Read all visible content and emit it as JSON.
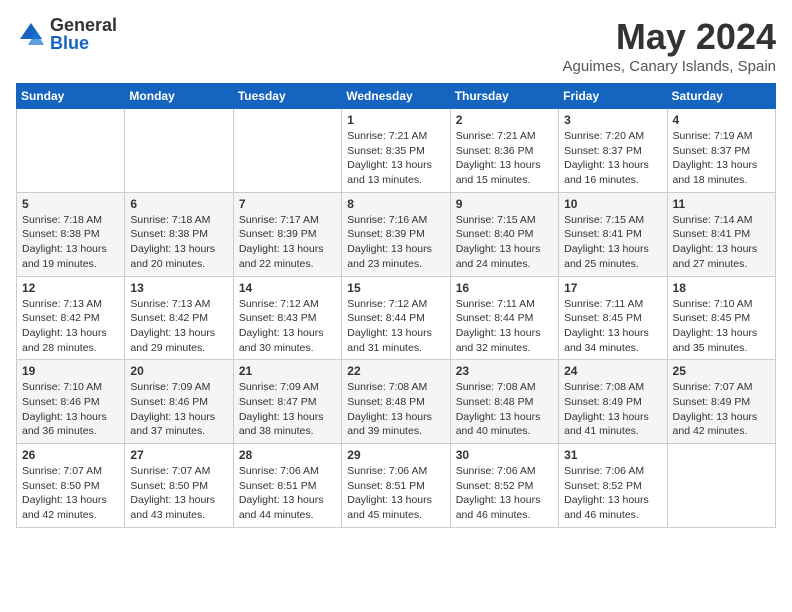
{
  "header": {
    "logo_general": "General",
    "logo_blue": "Blue",
    "month_title": "May 2024",
    "location": "Aguimes, Canary Islands, Spain"
  },
  "calendar": {
    "days_of_week": [
      "Sunday",
      "Monday",
      "Tuesday",
      "Wednesday",
      "Thursday",
      "Friday",
      "Saturday"
    ],
    "weeks": [
      [
        {
          "day": "",
          "info": ""
        },
        {
          "day": "",
          "info": ""
        },
        {
          "day": "",
          "info": ""
        },
        {
          "day": "1",
          "info": "Sunrise: 7:21 AM\nSunset: 8:35 PM\nDaylight: 13 hours and 13 minutes."
        },
        {
          "day": "2",
          "info": "Sunrise: 7:21 AM\nSunset: 8:36 PM\nDaylight: 13 hours and 15 minutes."
        },
        {
          "day": "3",
          "info": "Sunrise: 7:20 AM\nSunset: 8:37 PM\nDaylight: 13 hours and 16 minutes."
        },
        {
          "day": "4",
          "info": "Sunrise: 7:19 AM\nSunset: 8:37 PM\nDaylight: 13 hours and 18 minutes."
        }
      ],
      [
        {
          "day": "5",
          "info": "Sunrise: 7:18 AM\nSunset: 8:38 PM\nDaylight: 13 hours and 19 minutes."
        },
        {
          "day": "6",
          "info": "Sunrise: 7:18 AM\nSunset: 8:38 PM\nDaylight: 13 hours and 20 minutes."
        },
        {
          "day": "7",
          "info": "Sunrise: 7:17 AM\nSunset: 8:39 PM\nDaylight: 13 hours and 22 minutes."
        },
        {
          "day": "8",
          "info": "Sunrise: 7:16 AM\nSunset: 8:39 PM\nDaylight: 13 hours and 23 minutes."
        },
        {
          "day": "9",
          "info": "Sunrise: 7:15 AM\nSunset: 8:40 PM\nDaylight: 13 hours and 24 minutes."
        },
        {
          "day": "10",
          "info": "Sunrise: 7:15 AM\nSunset: 8:41 PM\nDaylight: 13 hours and 25 minutes."
        },
        {
          "day": "11",
          "info": "Sunrise: 7:14 AM\nSunset: 8:41 PM\nDaylight: 13 hours and 27 minutes."
        }
      ],
      [
        {
          "day": "12",
          "info": "Sunrise: 7:13 AM\nSunset: 8:42 PM\nDaylight: 13 hours and 28 minutes."
        },
        {
          "day": "13",
          "info": "Sunrise: 7:13 AM\nSunset: 8:42 PM\nDaylight: 13 hours and 29 minutes."
        },
        {
          "day": "14",
          "info": "Sunrise: 7:12 AM\nSunset: 8:43 PM\nDaylight: 13 hours and 30 minutes."
        },
        {
          "day": "15",
          "info": "Sunrise: 7:12 AM\nSunset: 8:44 PM\nDaylight: 13 hours and 31 minutes."
        },
        {
          "day": "16",
          "info": "Sunrise: 7:11 AM\nSunset: 8:44 PM\nDaylight: 13 hours and 32 minutes."
        },
        {
          "day": "17",
          "info": "Sunrise: 7:11 AM\nSunset: 8:45 PM\nDaylight: 13 hours and 34 minutes."
        },
        {
          "day": "18",
          "info": "Sunrise: 7:10 AM\nSunset: 8:45 PM\nDaylight: 13 hours and 35 minutes."
        }
      ],
      [
        {
          "day": "19",
          "info": "Sunrise: 7:10 AM\nSunset: 8:46 PM\nDaylight: 13 hours and 36 minutes."
        },
        {
          "day": "20",
          "info": "Sunrise: 7:09 AM\nSunset: 8:46 PM\nDaylight: 13 hours and 37 minutes."
        },
        {
          "day": "21",
          "info": "Sunrise: 7:09 AM\nSunset: 8:47 PM\nDaylight: 13 hours and 38 minutes."
        },
        {
          "day": "22",
          "info": "Sunrise: 7:08 AM\nSunset: 8:48 PM\nDaylight: 13 hours and 39 minutes."
        },
        {
          "day": "23",
          "info": "Sunrise: 7:08 AM\nSunset: 8:48 PM\nDaylight: 13 hours and 40 minutes."
        },
        {
          "day": "24",
          "info": "Sunrise: 7:08 AM\nSunset: 8:49 PM\nDaylight: 13 hours and 41 minutes."
        },
        {
          "day": "25",
          "info": "Sunrise: 7:07 AM\nSunset: 8:49 PM\nDaylight: 13 hours and 42 minutes."
        }
      ],
      [
        {
          "day": "26",
          "info": "Sunrise: 7:07 AM\nSunset: 8:50 PM\nDaylight: 13 hours and 42 minutes."
        },
        {
          "day": "27",
          "info": "Sunrise: 7:07 AM\nSunset: 8:50 PM\nDaylight: 13 hours and 43 minutes."
        },
        {
          "day": "28",
          "info": "Sunrise: 7:06 AM\nSunset: 8:51 PM\nDaylight: 13 hours and 44 minutes."
        },
        {
          "day": "29",
          "info": "Sunrise: 7:06 AM\nSunset: 8:51 PM\nDaylight: 13 hours and 45 minutes."
        },
        {
          "day": "30",
          "info": "Sunrise: 7:06 AM\nSunset: 8:52 PM\nDaylight: 13 hours and 46 minutes."
        },
        {
          "day": "31",
          "info": "Sunrise: 7:06 AM\nSunset: 8:52 PM\nDaylight: 13 hours and 46 minutes."
        },
        {
          "day": "",
          "info": ""
        }
      ]
    ]
  }
}
